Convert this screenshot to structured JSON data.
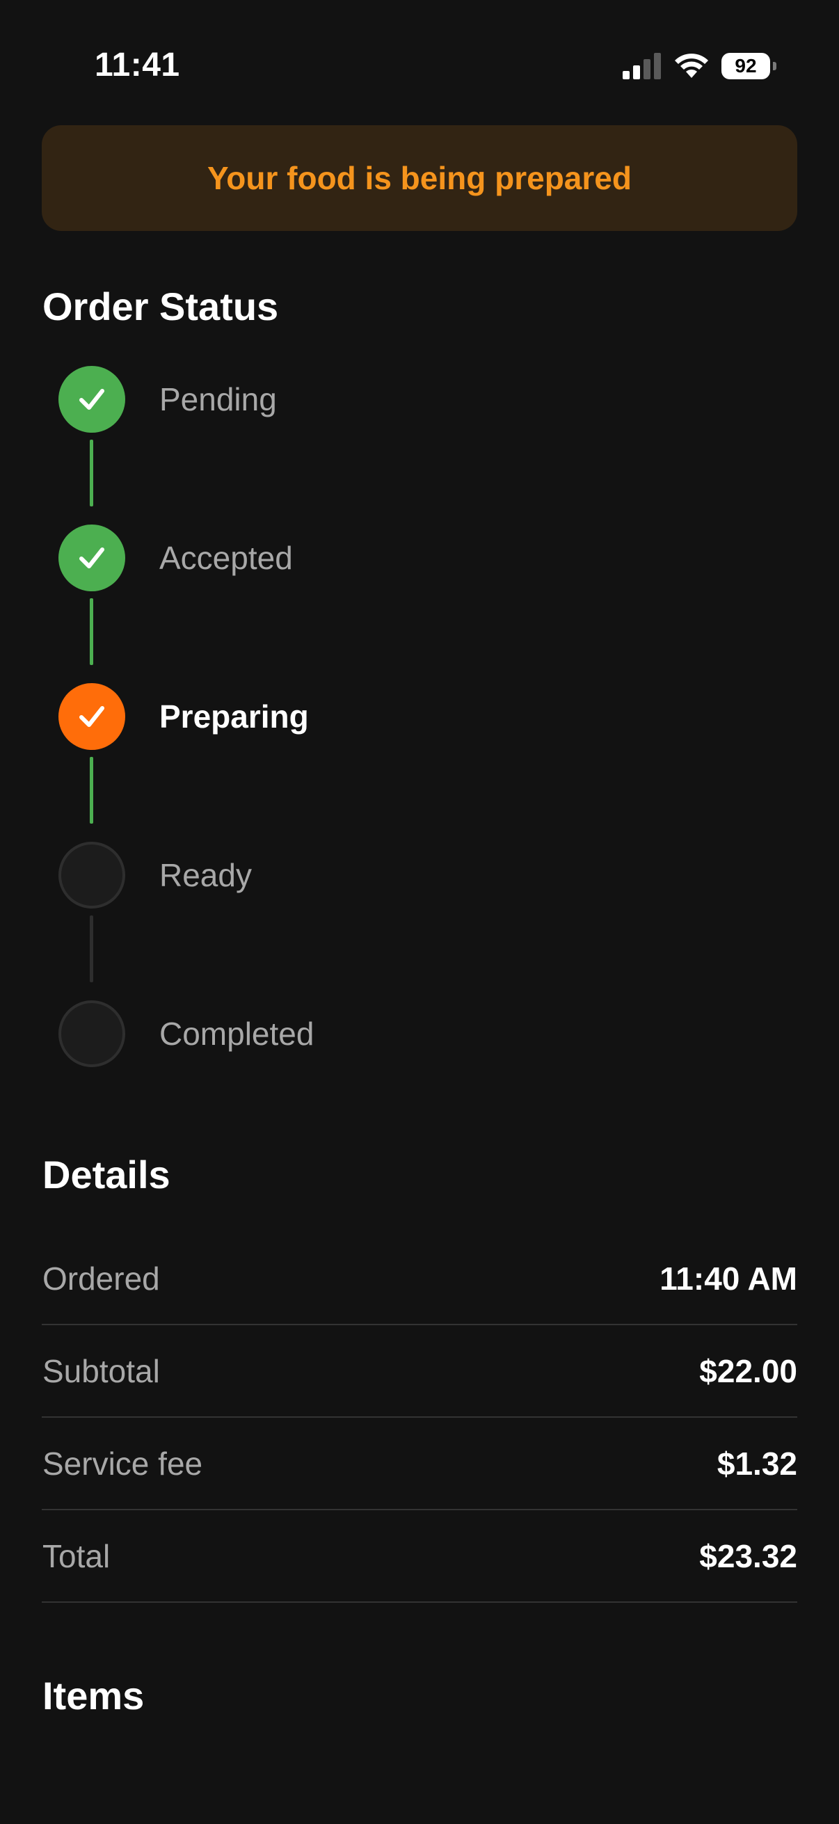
{
  "status_bar": {
    "time": "11:41",
    "battery": "92"
  },
  "banner": {
    "text": "Your food is being prepared",
    "color": "#f5941d"
  },
  "order_status": {
    "title": "Order Status",
    "steps": [
      {
        "label": "Pending",
        "state": "done"
      },
      {
        "label": "Accepted",
        "state": "done"
      },
      {
        "label": "Preparing",
        "state": "active"
      },
      {
        "label": "Ready",
        "state": "pending"
      },
      {
        "label": "Completed",
        "state": "pending"
      }
    ]
  },
  "details": {
    "title": "Details",
    "rows": [
      {
        "label": "Ordered",
        "value": "11:40 AM"
      },
      {
        "label": "Subtotal",
        "value": "$22.00"
      },
      {
        "label": "Service fee",
        "value": "$1.32"
      },
      {
        "label": "Total",
        "value": "$23.32"
      }
    ]
  },
  "items": {
    "title": "Items"
  },
  "colors": {
    "done": "#4caf50",
    "active": "#ff6d0a",
    "background": "#121212"
  }
}
